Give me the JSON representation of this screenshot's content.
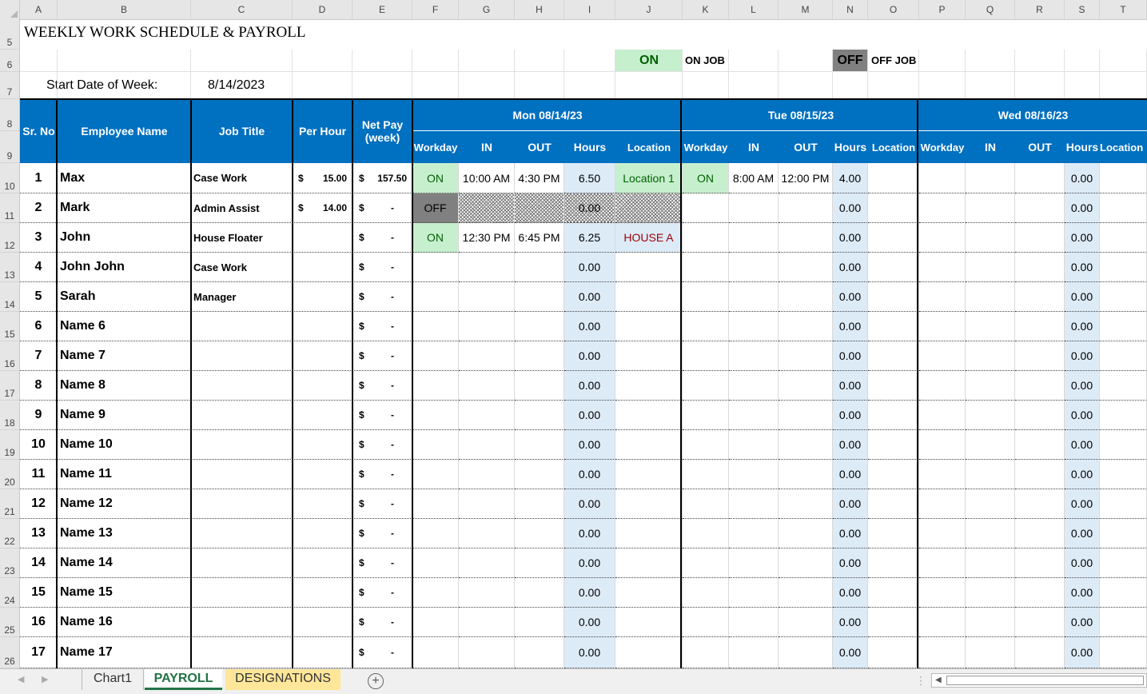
{
  "columns": [
    "A",
    "B",
    "C",
    "D",
    "E",
    "F",
    "G",
    "H",
    "I",
    "J",
    "K",
    "L",
    "M",
    "N",
    "O",
    "P",
    "Q",
    "R",
    "S",
    "T"
  ],
  "rows": [
    "5",
    "6",
    "7",
    "8",
    "9",
    "10",
    "11",
    "12",
    "13",
    "14",
    "15",
    "16",
    "17",
    "18",
    "19",
    "20",
    "21",
    "22",
    "23",
    "24",
    "25",
    "26"
  ],
  "title": "WEEKLY WORK SCHEDULE & PAYROLL",
  "legend": {
    "on_badge": "ON",
    "on_label": "ON JOB",
    "off_badge": "OFF",
    "off_label": "OFF JOB",
    "on_color": "#c6efce",
    "off_color": "#808080"
  },
  "start_label": "Start Date of Week:",
  "start_date": "8/14/2023",
  "headers": {
    "sr": "Sr. No",
    "name": "Employee Name",
    "job": "Job Title",
    "per_hour": "Per Hour",
    "net_pay": "Net Pay (week)"
  },
  "days": [
    "Mon 08/14/23",
    "Tue 08/15/23",
    "Wed 08/16/23"
  ],
  "sub_headers": [
    "Workday",
    "IN",
    "OUT",
    "Hours",
    "Location"
  ],
  "employees": [
    {
      "no": "1",
      "name": "Max",
      "job": "Case Work",
      "rate": "15.00",
      "pay": "157.50",
      "mon": {
        "wd": "ON",
        "in": "10:00 AM",
        "out": "4:30 PM",
        "hours": "6.50",
        "loc": "Location 1"
      },
      "tue": {
        "wd": "ON",
        "in": "8:00 AM",
        "out": "12:00 PM",
        "hours": "4.00",
        "loc": ""
      },
      "wed": {
        "wd": "",
        "in": "",
        "out": "",
        "hours": "0.00",
        "loc": ""
      }
    },
    {
      "no": "2",
      "name": "Mark",
      "job": "Admin Assist",
      "rate": "14.00",
      "pay": "-",
      "mon": {
        "wd": "OFF",
        "in": "",
        "out": "",
        "hours": "0.00",
        "loc": ""
      },
      "tue": {
        "wd": "",
        "in": "",
        "out": "",
        "hours": "0.00",
        "loc": ""
      },
      "wed": {
        "wd": "",
        "in": "",
        "out": "",
        "hours": "0.00",
        "loc": ""
      }
    },
    {
      "no": "3",
      "name": "John",
      "job": "House Floater",
      "rate": "",
      "pay": "-",
      "mon": {
        "wd": "ON",
        "in": "12:30 PM",
        "out": "6:45 PM",
        "hours": "6.25",
        "loc": "HOUSE A"
      },
      "tue": {
        "wd": "",
        "in": "",
        "out": "",
        "hours": "0.00",
        "loc": ""
      },
      "wed": {
        "wd": "",
        "in": "",
        "out": "",
        "hours": "0.00",
        "loc": ""
      }
    },
    {
      "no": "4",
      "name": "John John",
      "job": "Case Work",
      "rate": "",
      "pay": "-",
      "mon": {
        "hours": "0.00"
      },
      "tue": {
        "hours": "0.00"
      },
      "wed": {
        "hours": "0.00"
      }
    },
    {
      "no": "5",
      "name": "Sarah",
      "job": "Manager",
      "rate": "",
      "pay": "-",
      "mon": {
        "hours": "0.00"
      },
      "tue": {
        "hours": "0.00"
      },
      "wed": {
        "hours": "0.00"
      }
    },
    {
      "no": "6",
      "name": "Name 6",
      "job": "",
      "rate": "",
      "pay": "-",
      "mon": {
        "hours": "0.00"
      },
      "tue": {
        "hours": "0.00"
      },
      "wed": {
        "hours": "0.00"
      }
    },
    {
      "no": "7",
      "name": "Name 7",
      "job": "",
      "rate": "",
      "pay": "-",
      "mon": {
        "hours": "0.00"
      },
      "tue": {
        "hours": "0.00"
      },
      "wed": {
        "hours": "0.00"
      }
    },
    {
      "no": "8",
      "name": "Name 8",
      "job": "",
      "rate": "",
      "pay": "-",
      "mon": {
        "hours": "0.00"
      },
      "tue": {
        "hours": "0.00"
      },
      "wed": {
        "hours": "0.00"
      }
    },
    {
      "no": "9",
      "name": "Name 9",
      "job": "",
      "rate": "",
      "pay": "-",
      "mon": {
        "hours": "0.00"
      },
      "tue": {
        "hours": "0.00"
      },
      "wed": {
        "hours": "0.00"
      }
    },
    {
      "no": "10",
      "name": "Name 10",
      "job": "",
      "rate": "",
      "pay": "-",
      "mon": {
        "hours": "0.00"
      },
      "tue": {
        "hours": "0.00"
      },
      "wed": {
        "hours": "0.00"
      }
    },
    {
      "no": "11",
      "name": "Name 11",
      "job": "",
      "rate": "",
      "pay": "-",
      "mon": {
        "hours": "0.00"
      },
      "tue": {
        "hours": "0.00"
      },
      "wed": {
        "hours": "0.00"
      }
    },
    {
      "no": "12",
      "name": "Name 12",
      "job": "",
      "rate": "",
      "pay": "-",
      "mon": {
        "hours": "0.00"
      },
      "tue": {
        "hours": "0.00"
      },
      "wed": {
        "hours": "0.00"
      }
    },
    {
      "no": "13",
      "name": "Name 13",
      "job": "",
      "rate": "",
      "pay": "-",
      "mon": {
        "hours": "0.00"
      },
      "tue": {
        "hours": "0.00"
      },
      "wed": {
        "hours": "0.00"
      }
    },
    {
      "no": "14",
      "name": "Name 14",
      "job": "",
      "rate": "",
      "pay": "-",
      "mon": {
        "hours": "0.00"
      },
      "tue": {
        "hours": "0.00"
      },
      "wed": {
        "hours": "0.00"
      }
    },
    {
      "no": "15",
      "name": "Name 15",
      "job": "",
      "rate": "",
      "pay": "-",
      "mon": {
        "hours": "0.00"
      },
      "tue": {
        "hours": "0.00"
      },
      "wed": {
        "hours": "0.00"
      }
    },
    {
      "no": "16",
      "name": "Name 16",
      "job": "",
      "rate": "",
      "pay": "-",
      "mon": {
        "hours": "0.00"
      },
      "tue": {
        "hours": "0.00"
      },
      "wed": {
        "hours": "0.00"
      }
    },
    {
      "no": "17",
      "name": "Name 17",
      "job": "",
      "rate": "",
      "pay": "-",
      "mon": {
        "hours": "0.00"
      },
      "tue": {
        "hours": "0.00"
      },
      "wed": {
        "hours": "0.00"
      }
    }
  ],
  "currency": "$",
  "sheet_tabs": [
    {
      "label": "Chart1",
      "active": false
    },
    {
      "label": "PAYROLL",
      "active": true
    },
    {
      "label": "DESIGNATIONS",
      "active": false
    }
  ],
  "add_sheet_icon": "plus-circle-icon",
  "accent_color": "#0070c0"
}
